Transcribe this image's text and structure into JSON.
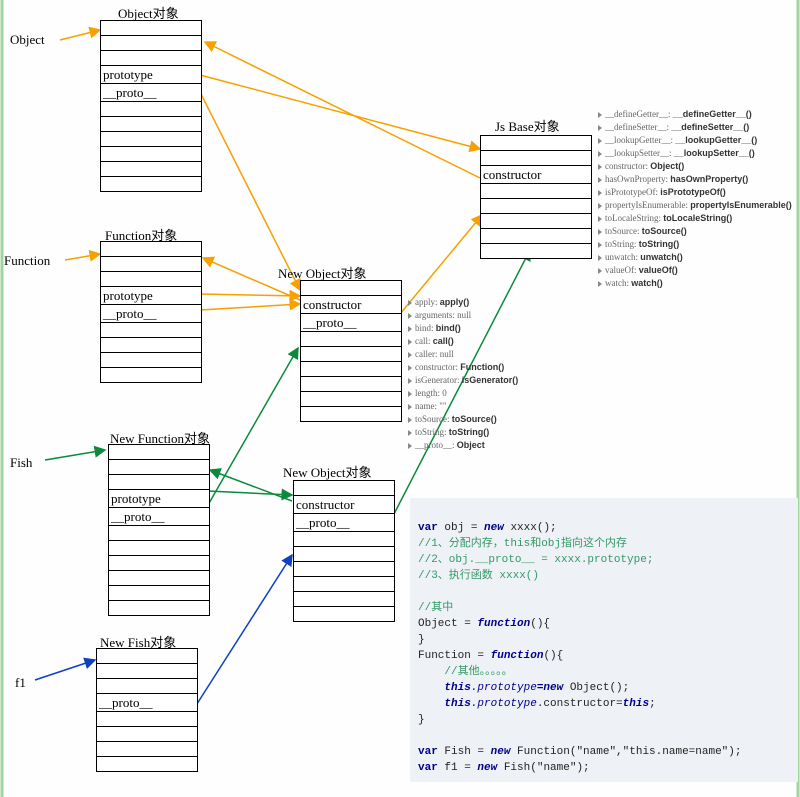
{
  "labels": {
    "object_var": "Object",
    "function_var": "Function",
    "fish_var": "Fish",
    "f1_var": "f1"
  },
  "titles": {
    "object_obj": "Object对象",
    "function_obj": "Function对象",
    "new_function_obj": "New Function对象",
    "new_fish_obj": "New Fish对象",
    "new_object_obj": "New Object对象",
    "js_base_obj": "Js Base对象"
  },
  "box_rows": {
    "empty": "",
    "prototype": "prototype",
    "__proto__": "__proto__",
    "constructor": "constructor"
  },
  "newobj_props": [
    {
      "k": "apply",
      "v": "apply()"
    },
    {
      "k": "arguments",
      "v": "null",
      "plain": true
    },
    {
      "k": "bind",
      "v": "bind()"
    },
    {
      "k": "call",
      "v": "call()"
    },
    {
      "k": "caller",
      "v": "null",
      "plain": true
    },
    {
      "k": "constructor",
      "v": "Function()"
    },
    {
      "k": "isGenerator",
      "v": "isGenerator()"
    },
    {
      "k": "length",
      "v": "0",
      "plain": true
    },
    {
      "k": "name",
      "v": "\"\"",
      "plain": true
    },
    {
      "k": "toSource",
      "v": "toSource()"
    },
    {
      "k": "toString",
      "v": "toString()"
    },
    {
      "k": "__proto__",
      "v": "Object"
    }
  ],
  "jsbase_props": [
    {
      "k": "__defineGetter__",
      "v": "__defineGetter__()"
    },
    {
      "k": "__defineSetter__",
      "v": "__defineSetter__()"
    },
    {
      "k": "__lookupGetter__",
      "v": "__lookupGetter__()"
    },
    {
      "k": "__lookupSetter__",
      "v": "__lookupSetter__()"
    },
    {
      "k": "constructor",
      "v": "Object()"
    },
    {
      "k": "hasOwnProperty",
      "v": "hasOwnProperty()"
    },
    {
      "k": "isPrototypeOf",
      "v": "isPrototypeOf()"
    },
    {
      "k": "propertyIsEnumerable",
      "v": "propertyIsEnumerable()"
    },
    {
      "k": "toLocaleString",
      "v": "toLocaleString()"
    },
    {
      "k": "toSource",
      "v": "toSource()"
    },
    {
      "k": "toString",
      "v": "toString()"
    },
    {
      "k": "unwatch",
      "v": "unwatch()"
    },
    {
      "k": "valueOf",
      "v": "valueOf()"
    },
    {
      "k": "watch",
      "v": "watch()"
    }
  ],
  "code": {
    "line1": "var obj = new xxxx();",
    "line2": "//1、分配内存，this和obj指向这个内存",
    "line3": "//2、obj.__proto__ = xxxx.prototype;",
    "line4": "//3、执行函数 xxxx()",
    "line5": "//其中",
    "line6a": "Object = ",
    "line6b": "function",
    "line6c": "(){",
    "line7": "}",
    "line8a": "Function = ",
    "line8b": "function",
    "line8c": "(){",
    "line9": "    //其他。。。。。",
    "line10a": "    this",
    "line10b": ".prototype",
    "line10c": "=new",
    "line10d": " Object();",
    "line11a": "    this",
    "line11b": ".prototype",
    "line11c": ".constructor=",
    "line11d": "this",
    "line11e": ";",
    "line12": "}",
    "line13a": "var",
    "line13b": " Fish = ",
    "line13c": "new",
    "line13d": " Function(\"name\",\"this.name=name\");",
    "line14a": "var",
    "line14b": " f1 = ",
    "line14c": "new",
    "line14d": " Fish(\"name\");"
  }
}
